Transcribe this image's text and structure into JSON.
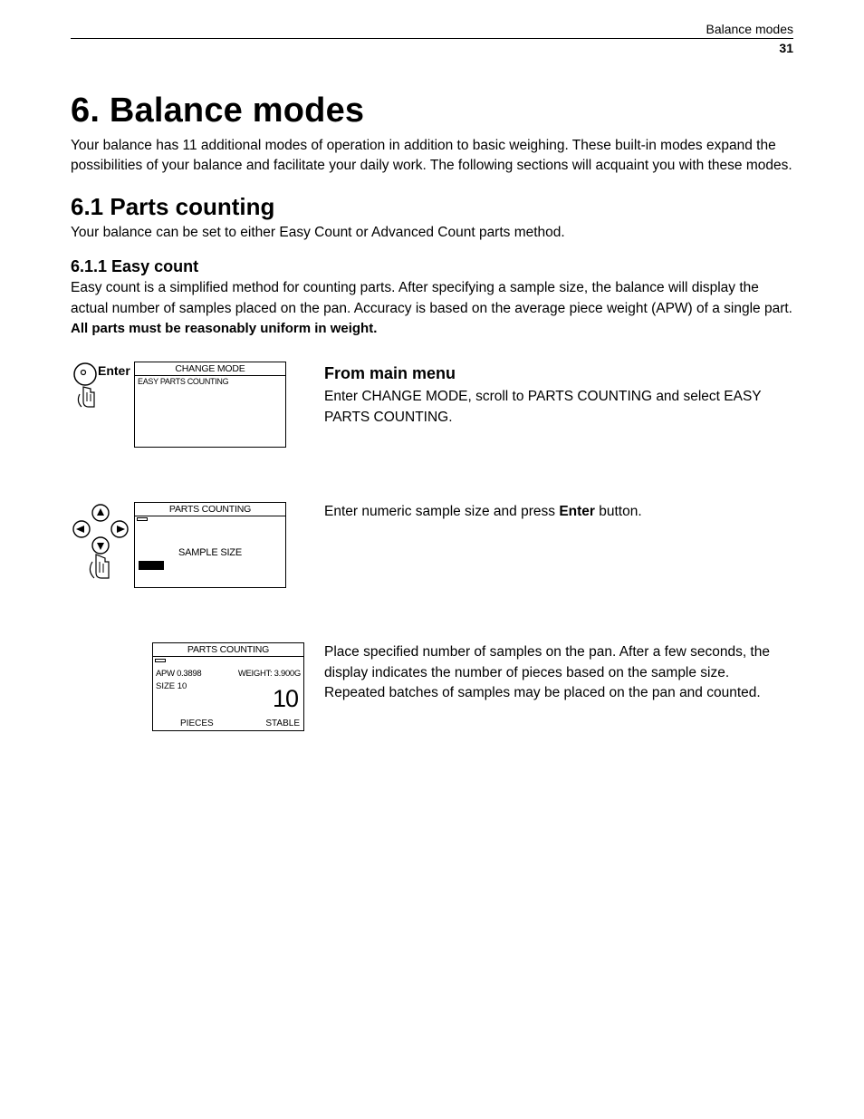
{
  "header": {
    "running_head": "Balance modes",
    "page_number": "31"
  },
  "title": "6.  Balance modes",
  "intro": "Your balance has 11 additional modes of operation in addition to basic weighing. These built-in modes expand the possibilities of your balance and facilitate your daily work. The following sections will acquaint you with these modes.",
  "sec_6_1": {
    "heading": "6.1  Parts counting",
    "body": "Your balance can be set to either Easy Count or Advanced Count parts method."
  },
  "sec_6_1_1": {
    "heading": "6.1.1 Easy count",
    "body": "Easy count is a simplified method for counting parts. After specifying a sample size, the balance will display the actual number of samples placed on the pan. Accuracy is based on the average piece weight (APW) of a single part.",
    "note": "All parts must be reasonably uniform in weight."
  },
  "step1": {
    "icon_label": "Enter",
    "lcd_title": "CHANGE MODE",
    "lcd_line2": "EASY PARTS COUNTING",
    "heading": "From main menu",
    "text": "Enter CHANGE MODE, scroll to PARTS COUNTING and select EASY PARTS COUNTING."
  },
  "step2": {
    "lcd_title": "PARTS COUNTING",
    "sample_label": "SAMPLE SIZE",
    "text_a": "Enter numeric sample size and press ",
    "enter_word": "Enter",
    "text_b": " button."
  },
  "step3": {
    "lcd_title": "PARTS COUNTING",
    "apw": "APW 0.3898",
    "weight": "WEIGHT: 3.900G",
    "size": "SIZE 10",
    "big_value": "10",
    "pieces": "PIECES",
    "stable": "STABLE",
    "text": "Place specified number of samples on the pan. After a few seconds, the display indicates the number of pieces based on the sample size. Repeated batches of samples may be placed on the pan and counted."
  }
}
